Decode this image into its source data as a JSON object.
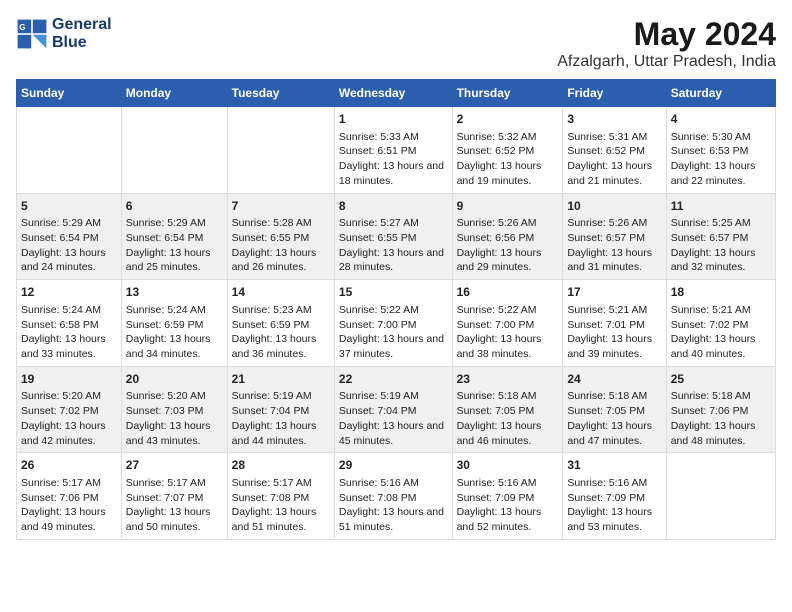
{
  "logo": {
    "line1": "General",
    "line2": "Blue"
  },
  "title": "May 2024",
  "subtitle": "Afzalgarh, Uttar Pradesh, India",
  "days_of_week": [
    "Sunday",
    "Monday",
    "Tuesday",
    "Wednesday",
    "Thursday",
    "Friday",
    "Saturday"
  ],
  "weeks": [
    {
      "cells": [
        {
          "day": "",
          "info": ""
        },
        {
          "day": "",
          "info": ""
        },
        {
          "day": "",
          "info": ""
        },
        {
          "day": "1",
          "info": "Sunrise: 5:33 AM\nSunset: 6:51 PM\nDaylight: 13 hours and 18 minutes."
        },
        {
          "day": "2",
          "info": "Sunrise: 5:32 AM\nSunset: 6:52 PM\nDaylight: 13 hours and 19 minutes."
        },
        {
          "day": "3",
          "info": "Sunrise: 5:31 AM\nSunset: 6:52 PM\nDaylight: 13 hours and 21 minutes."
        },
        {
          "day": "4",
          "info": "Sunrise: 5:30 AM\nSunset: 6:53 PM\nDaylight: 13 hours and 22 minutes."
        }
      ]
    },
    {
      "cells": [
        {
          "day": "5",
          "info": "Sunrise: 5:29 AM\nSunset: 6:54 PM\nDaylight: 13 hours and 24 minutes."
        },
        {
          "day": "6",
          "info": "Sunrise: 5:29 AM\nSunset: 6:54 PM\nDaylight: 13 hours and 25 minutes."
        },
        {
          "day": "7",
          "info": "Sunrise: 5:28 AM\nSunset: 6:55 PM\nDaylight: 13 hours and 26 minutes."
        },
        {
          "day": "8",
          "info": "Sunrise: 5:27 AM\nSunset: 6:55 PM\nDaylight: 13 hours and 28 minutes."
        },
        {
          "day": "9",
          "info": "Sunrise: 5:26 AM\nSunset: 6:56 PM\nDaylight: 13 hours and 29 minutes."
        },
        {
          "day": "10",
          "info": "Sunrise: 5:26 AM\nSunset: 6:57 PM\nDaylight: 13 hours and 31 minutes."
        },
        {
          "day": "11",
          "info": "Sunrise: 5:25 AM\nSunset: 6:57 PM\nDaylight: 13 hours and 32 minutes."
        }
      ]
    },
    {
      "cells": [
        {
          "day": "12",
          "info": "Sunrise: 5:24 AM\nSunset: 6:58 PM\nDaylight: 13 hours and 33 minutes."
        },
        {
          "day": "13",
          "info": "Sunrise: 5:24 AM\nSunset: 6:59 PM\nDaylight: 13 hours and 34 minutes."
        },
        {
          "day": "14",
          "info": "Sunrise: 5:23 AM\nSunset: 6:59 PM\nDaylight: 13 hours and 36 minutes."
        },
        {
          "day": "15",
          "info": "Sunrise: 5:22 AM\nSunset: 7:00 PM\nDaylight: 13 hours and 37 minutes."
        },
        {
          "day": "16",
          "info": "Sunrise: 5:22 AM\nSunset: 7:00 PM\nDaylight: 13 hours and 38 minutes."
        },
        {
          "day": "17",
          "info": "Sunrise: 5:21 AM\nSunset: 7:01 PM\nDaylight: 13 hours and 39 minutes."
        },
        {
          "day": "18",
          "info": "Sunrise: 5:21 AM\nSunset: 7:02 PM\nDaylight: 13 hours and 40 minutes."
        }
      ]
    },
    {
      "cells": [
        {
          "day": "19",
          "info": "Sunrise: 5:20 AM\nSunset: 7:02 PM\nDaylight: 13 hours and 42 minutes."
        },
        {
          "day": "20",
          "info": "Sunrise: 5:20 AM\nSunset: 7:03 PM\nDaylight: 13 hours and 43 minutes."
        },
        {
          "day": "21",
          "info": "Sunrise: 5:19 AM\nSunset: 7:04 PM\nDaylight: 13 hours and 44 minutes."
        },
        {
          "day": "22",
          "info": "Sunrise: 5:19 AM\nSunset: 7:04 PM\nDaylight: 13 hours and 45 minutes."
        },
        {
          "day": "23",
          "info": "Sunrise: 5:18 AM\nSunset: 7:05 PM\nDaylight: 13 hours and 46 minutes."
        },
        {
          "day": "24",
          "info": "Sunrise: 5:18 AM\nSunset: 7:05 PM\nDaylight: 13 hours and 47 minutes."
        },
        {
          "day": "25",
          "info": "Sunrise: 5:18 AM\nSunset: 7:06 PM\nDaylight: 13 hours and 48 minutes."
        }
      ]
    },
    {
      "cells": [
        {
          "day": "26",
          "info": "Sunrise: 5:17 AM\nSunset: 7:06 PM\nDaylight: 13 hours and 49 minutes."
        },
        {
          "day": "27",
          "info": "Sunrise: 5:17 AM\nSunset: 7:07 PM\nDaylight: 13 hours and 50 minutes."
        },
        {
          "day": "28",
          "info": "Sunrise: 5:17 AM\nSunset: 7:08 PM\nDaylight: 13 hours and 51 minutes."
        },
        {
          "day": "29",
          "info": "Sunrise: 5:16 AM\nSunset: 7:08 PM\nDaylight: 13 hours and 51 minutes."
        },
        {
          "day": "30",
          "info": "Sunrise: 5:16 AM\nSunset: 7:09 PM\nDaylight: 13 hours and 52 minutes."
        },
        {
          "day": "31",
          "info": "Sunrise: 5:16 AM\nSunset: 7:09 PM\nDaylight: 13 hours and 53 minutes."
        },
        {
          "day": "",
          "info": ""
        }
      ]
    }
  ]
}
